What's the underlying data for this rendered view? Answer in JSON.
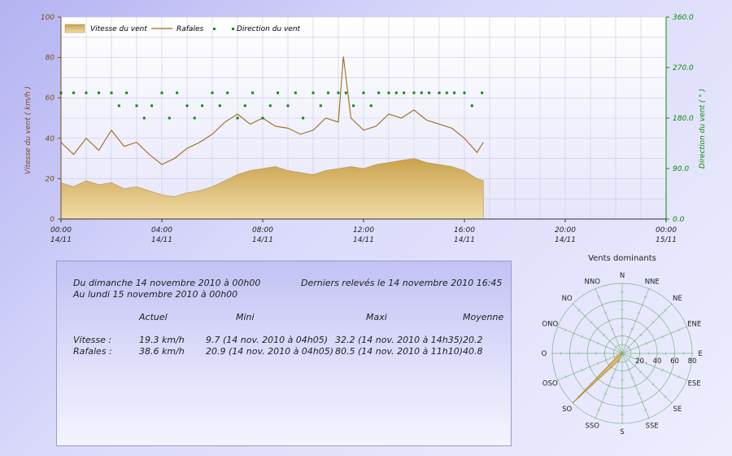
{
  "colors": {
    "speed_fill_top": "#c9a24f",
    "speed_fill_bottom": "#f0dca6",
    "gust_line": "#a06a1c",
    "direction_points": "#0a8a0a",
    "left_axis": "#7a4e14",
    "right_axis": "#0a8a0a",
    "grid": "#c9c9e6"
  },
  "chart_data": [
    {
      "type": "line",
      "legend": [
        "Vitesse du vent",
        "Rafales",
        "Direction du vent"
      ],
      "ylabel": "Vitesse du vent ( km/h )",
      "y2label": "Direction du vent ( ° )",
      "ylim": [
        0,
        100
      ],
      "y2lim": [
        0,
        360
      ],
      "yticks": [
        "0",
        "20",
        "40",
        "60",
        "80",
        "100"
      ],
      "y2ticks": [
        "0.0",
        "90.0",
        "180.0",
        "270.0",
        "360.0"
      ],
      "xlim_hours": [
        0,
        24
      ],
      "xticks": [
        {
          "time": "00:00",
          "date": "14/11"
        },
        {
          "time": "04:00",
          "date": "14/11"
        },
        {
          "time": "08:00",
          "date": "14/11"
        },
        {
          "time": "12:00",
          "date": "14/11"
        },
        {
          "time": "16:00",
          "date": "14/11"
        },
        {
          "time": "20:00",
          "date": "14/11"
        },
        {
          "time": "00:00",
          "date": "15/11"
        }
      ],
      "series": [
        {
          "name": "Vitesse du vent",
          "style": "area",
          "x_hours": [
            0,
            0.5,
            1,
            1.5,
            2,
            2.5,
            3,
            3.5,
            4,
            4.5,
            5,
            5.5,
            6,
            6.5,
            7,
            7.5,
            8,
            8.5,
            9,
            9.5,
            10,
            10.5,
            11,
            11.5,
            12,
            12.5,
            13,
            13.5,
            14,
            14.5,
            15,
            15.5,
            16,
            16.5,
            16.75
          ],
          "values": [
            18,
            16,
            19,
            17,
            18,
            15,
            16,
            14,
            12,
            11,
            13,
            14,
            16,
            19,
            22,
            24,
            25,
            26,
            24,
            23,
            22,
            24,
            25,
            26,
            25,
            27,
            28,
            29,
            30,
            28,
            27,
            26,
            24,
            20,
            19
          ]
        },
        {
          "name": "Rafales",
          "style": "line",
          "x_hours": [
            0,
            0.5,
            1,
            1.5,
            2,
            2.5,
            3,
            3.5,
            4,
            4.5,
            5,
            5.5,
            6,
            6.5,
            7,
            7.5,
            8,
            8.5,
            9,
            9.5,
            10,
            10.5,
            11,
            11.2,
            11.5,
            12,
            12.5,
            13,
            13.5,
            14,
            14.5,
            15,
            15.5,
            16,
            16.5,
            16.75
          ],
          "values": [
            38,
            32,
            40,
            34,
            44,
            36,
            38,
            32,
            27,
            30,
            35,
            38,
            42,
            48,
            52,
            47,
            50,
            46,
            45,
            42,
            44,
            50,
            48,
            80.5,
            50,
            44,
            46,
            52,
            50,
            54,
            49,
            47,
            45,
            40,
            33,
            38
          ]
        },
        {
          "name": "Direction du vent",
          "style": "points",
          "unit": "deg",
          "x_hours": [
            0,
            0.5,
            1,
            1.5,
            2,
            2.3,
            2.6,
            3,
            3.3,
            3.6,
            4,
            4.3,
            4.6,
            5,
            5.3,
            5.6,
            6,
            6.3,
            6.6,
            7,
            7.3,
            7.6,
            8,
            8.3,
            8.6,
            9,
            9.3,
            9.6,
            10,
            10.3,
            10.6,
            11,
            11.3,
            11.6,
            12,
            12.3,
            12.6,
            13,
            13.3,
            13.6,
            14,
            14.3,
            14.6,
            15,
            15.3,
            15.6,
            16,
            16.3,
            16.7
          ],
          "values": [
            225,
            225,
            225,
            225,
            225,
            202,
            225,
            202,
            180,
            202,
            225,
            180,
            225,
            202,
            180,
            202,
            225,
            202,
            225,
            180,
            202,
            225,
            180,
            202,
            225,
            202,
            225,
            180,
            225,
            202,
            225,
            225,
            225,
            202,
            225,
            202,
            225,
            225,
            225,
            225,
            225,
            225,
            225,
            225,
            225,
            225,
            225,
            202,
            225
          ]
        }
      ]
    },
    {
      "type": "radar",
      "title": "Vents dominants",
      "directions": [
        "N",
        "NNE",
        "NE",
        "ENE",
        "E",
        "ESE",
        "SE",
        "SSE",
        "S",
        "SSO",
        "SO",
        "OSO",
        "O",
        "ONO",
        "NO",
        "NNO"
      ],
      "radial_ticks": [
        "20",
        "40",
        "60",
        "80"
      ],
      "rlim": [
        0,
        80
      ],
      "values": [
        0,
        0,
        0,
        0,
        0,
        0,
        0,
        0,
        0,
        8,
        80,
        4,
        0,
        0,
        0,
        0
      ]
    }
  ],
  "stats": {
    "period_from": "Du dimanche 14 novembre 2010 à 00h00",
    "period_to": "Au lundi 15 novembre 2010 à 00h00",
    "last_reading": "Derniers relevés le 14 novembre 2010 16:45",
    "headers": {
      "actual": "Actuel",
      "min": "Mini",
      "max": "Maxi",
      "avg": "Moyenne"
    },
    "rows": [
      {
        "label": "Vitesse :",
        "actual": "19.3 km/h",
        "min": "9.7 (14 nov. 2010 à 04h05)",
        "max": "32.2 (14 nov. 2010 à 14h35)",
        "avg": "20.2"
      },
      {
        "label": "Rafales :",
        "actual": "38.6 km/h",
        "min": "20.9 (14 nov. 2010 à 04h05)",
        "max": "80.5 (14 nov. 2010 à 11h10)",
        "avg": "40.8"
      }
    ]
  }
}
